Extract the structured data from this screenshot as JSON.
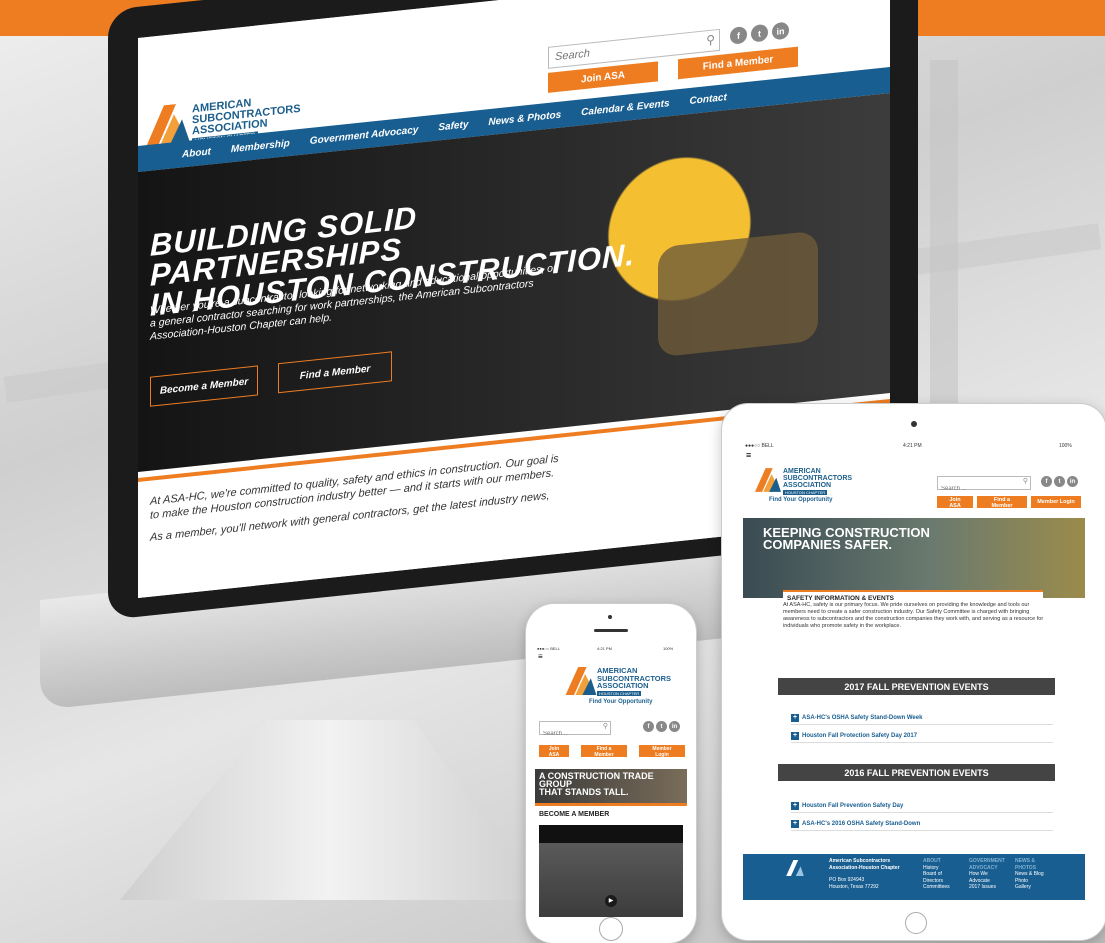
{
  "colors": {
    "orange": "#ee7d22",
    "blue": "#185e91",
    "dark": "#1b1b1b"
  },
  "logo": {
    "line1": "AMERICAN",
    "line2": "SUBCONTRACTORS",
    "line3": "ASSOCIATION",
    "line4": "HOUSTON CHAPTER",
    "tagline": "Find Your Opportunity"
  },
  "desktop": {
    "search_placeholder": "Search",
    "join": "Join ASA",
    "find": "Find a Member",
    "social": [
      "f",
      "t",
      "in"
    ],
    "nav": [
      "About",
      "Membership",
      "Government Advocacy",
      "Safety",
      "News & Photos",
      "Calendar & Events",
      "Contact"
    ],
    "headline1": "BUILDING SOLID PARTNERSHIPS",
    "headline2": "IN HOUSTON CONSTRUCTION.",
    "copy": "Whether you're a subcontractor looking for networking and educational opportunities, or a general contractor searching for work partnerships, the American Subcontractors Association-Houston Chapter can help.",
    "become": "Become a Member",
    "find_btn": "Find a Member",
    "intro1": "At ASA-HC, we're committed to quality, safety and ethics in construction. Our goal is to make the Houston construction industry better — and it starts with our members.",
    "intro2": "As a member, you'll network with general contractors, get the latest industry news,"
  },
  "tablet": {
    "carrier": "●●●○○ BELL ",
    "time": "4:21 PM",
    "battery": "100%",
    "menu": "≡",
    "search_placeholder": "Search ...",
    "join": "Join ASA",
    "find": "Find a Member",
    "login": "Member Login",
    "hero1": "KEEPING CONSTRUCTION",
    "hero2": "COMPANIES SAFER.",
    "section_title": "SAFETY INFORMATION & EVENTS",
    "section_text": "At ASA-HC, safety is our primary focus. We pride ourselves on providing the knowledge and tools our members need to create a safer construction industry. Our Safety Committee is charged with bringing awareness to subcontractors and the construction companies they work with, and serving as a resource for individuals who promote safety in the workplace.",
    "events2017": "2017 FALL PREVENTION EVENTS",
    "events2017_items": [
      "ASA-HC's OSHA Safety Stand-Down Week",
      "Houston Fall Protection Safety Day 2017"
    ],
    "events2016": "2016 FALL PREVENTION EVENTS",
    "events2016_items": [
      "Houston Fall Prevention Safety Day",
      "ASA-HC's 2016 OSHA Safety Stand-Down"
    ],
    "footer": {
      "org1": "American Subcontractors",
      "org2": "Association-Houston Chapter",
      "addr1": "PO Box 924943",
      "addr2": "Houston, Texas 77292",
      "col1_head": "ABOUT",
      "col1": [
        "History",
        "Board of",
        "Directors",
        "Committees"
      ],
      "col2_head1": "GOVERNMENT",
      "col2_head2": "ADVOCACY",
      "col2": [
        "How We",
        "Advocate",
        "2017 Issues"
      ],
      "col3_head1": "NEWS &",
      "col3_head2": "PHOTOS",
      "col3": [
        "News & Blog",
        "Photo",
        "Gallery"
      ]
    }
  },
  "phone": {
    "carrier": "●●●○○ BELL ",
    "time": "4:21 PM",
    "battery": "100%",
    "menu": "≡",
    "search_placeholder": "Search ...",
    "join": "Join ASA",
    "find": "Find a Member",
    "login": "Member Login",
    "hero1": "A CONSTRUCTION TRADE GROUP",
    "hero2": "THAT STANDS TALL.",
    "section": "BECOME A MEMBER"
  }
}
